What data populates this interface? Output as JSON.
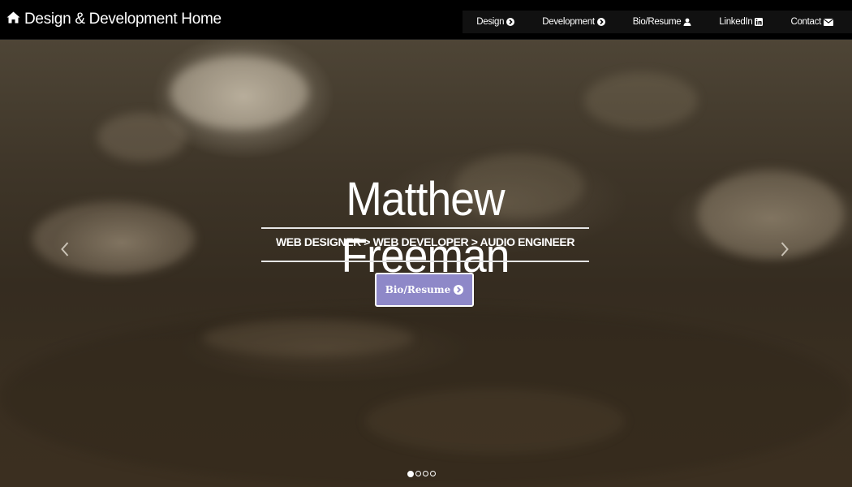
{
  "navbar": {
    "brand": "Design & Development Home",
    "items": [
      {
        "label": "Design",
        "icon": "chevron-circle-right-icon"
      },
      {
        "label": "Development",
        "icon": "chevron-circle-right-icon"
      },
      {
        "label": "Bio/Resume",
        "icon": "user-icon"
      },
      {
        "label": "LinkedIn",
        "icon": "linkedin-icon"
      },
      {
        "label": "Contact",
        "icon": "envelope-icon"
      }
    ]
  },
  "hero": {
    "title": "Matthew Freeman",
    "subtitle": "WEB DESIGNER > WEB DEVELOPER > AUDIO ENGINEER",
    "cta_label": "Bio/Resume",
    "slide_count": 4,
    "active_slide": 1
  },
  "colors": {
    "navbar_bg": "#000000",
    "cta_bg": "#8e88c8",
    "text": "#ffffff"
  }
}
